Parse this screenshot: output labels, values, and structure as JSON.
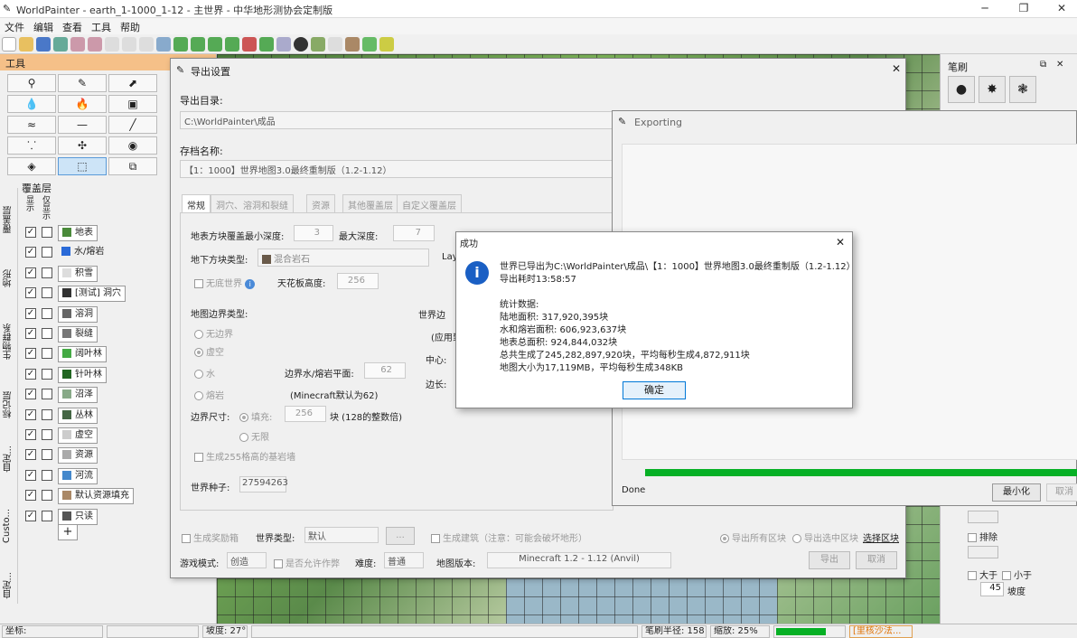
{
  "app": {
    "title": "WorldPainter - earth_1-1000_1-12 - 主世界 - 中华地形测协会定制版"
  },
  "menu": [
    "文件",
    "编辑",
    "查看",
    "工具",
    "帮助"
  ],
  "left_panel": {
    "tools_title": "工具",
    "layers_title": "覆盖层",
    "col_show": "显示",
    "col_solo": "仅显示",
    "vtabs": [
      "覆盖层",
      "地形",
      "生物群系",
      "标记层",
      "自定...",
      "Custo...",
      "自定..."
    ],
    "layers": [
      "地表",
      "水/熔岩",
      "积雪",
      "[测试] 洞穴",
      "溶洞",
      "裂缝",
      "阔叶林",
      "针叶林",
      "沼泽",
      "丛林",
      "虚空",
      "资源",
      "河流",
      "默认资源填充",
      "只读"
    ],
    "add": "+"
  },
  "right_panel": {
    "title": "笔刷",
    "exclude": "排除",
    "greater": "大于",
    "less": "小于",
    "slope_value": "45",
    "slope_label": "坡度"
  },
  "status": {
    "coords": "坐标:",
    "slope": "坡度: 27°",
    "brush_radius": "笔刷半径: 158",
    "zoom": "缩放: 25%",
    "alert": "[里核沙法..."
  },
  "export_dialog": {
    "title": "导出设置",
    "dir_label": "导出目录:",
    "dir_value": "C:\\WorldPainter\\成品",
    "name_label": "存档名称:",
    "name_value": "【1：1000】世界地图3.0最终重制版（1.2-1.12）",
    "tabs": [
      "常规",
      "洞穴、溶洞和裂缝",
      "资源",
      "其他覆盖层",
      "自定义覆盖层"
    ],
    "min_depth_label": "地表方块覆盖最小深度:",
    "min_depth": "3",
    "max_depth_label": "最大深度:",
    "max_depth": "7",
    "sub_label": "地下方块类型:",
    "sub_value": "混合岩石",
    "layer_short": "Lay",
    "bottomless": "无底世界",
    "ceiling_label": "天花板高度:",
    "ceiling": "256",
    "border_title": "地图边界类型:",
    "borders": [
      "无边界",
      "虚空",
      "水",
      "熔岩"
    ],
    "water_level_label": "边界水/熔岩平面:",
    "water_level": "62",
    "mc_default": "(Minecraft默认为62)",
    "border_size_label": "边界尺寸:",
    "fill": "填充:",
    "fill_value": "256",
    "blocks_note": "块 (128的整数倍)",
    "infinite": "无限",
    "bedrock": "生成255格高的基岩墙",
    "world_border": "世界边",
    "apply": "(应用到",
    "center": "中心:",
    "edge": "边长:",
    "seed_label": "世界种子:",
    "seed": "27594263",
    "bonus": "生成奖励箱",
    "world_type_label": "世界类型:",
    "world_type": "默认",
    "dots": "...",
    "structures": "生成建筑（注意：可能会破坏地形）",
    "export_all": "导出所有区块",
    "export_selected": "导出选中区块",
    "select_area": "选择区块",
    "gamemode_label": "游戏模式:",
    "gamemode": "创造",
    "cheats": "是否允许作弊",
    "difficulty_label": "难度:",
    "difficulty": "普通",
    "version_label": "地图版本:",
    "version": "Minecraft 1.2 - 1.12 (Anvil)",
    "export_btn": "导出",
    "cancel_btn": "取消"
  },
  "exporting": {
    "title": "Exporting",
    "done": "Done",
    "minimize": "最小化",
    "cancel": "取消"
  },
  "success": {
    "title": "成功",
    "line1": "世界已导出为C:\\WorldPainter\\成品\\【1：1000】世界地图3.0最终重制版（1.2-1.12）",
    "line2": "导出耗时13:58:57",
    "stats_title": "统计数据:",
    "land": "陆地面积: 317,920,395块",
    "water": "水和熔岩面积: 606,923,637块",
    "surface": "地表总面积: 924,844,032块",
    "total": "总共生成了245,282,897,920块，平均每秒生成4,872,911块",
    "size": "地图大小为17,119MB，平均每秒生成348KB",
    "ok": "确定"
  }
}
